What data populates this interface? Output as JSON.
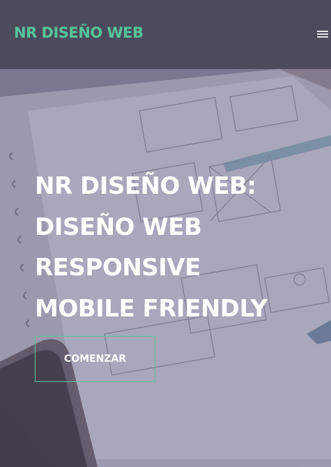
{
  "navbar": {
    "brand": "NR DISEÑO WEB",
    "menu_icon": "hamburger-menu-icon"
  },
  "hero": {
    "headline_lines": [
      "NR DISEÑO WEB:",
      "DISEÑO WEB",
      "RESPONSIVE",
      "MOBILE FRIENDLY"
    ],
    "cta_label": "COMENZAR",
    "background": "photo of notebook with website wireframe sketches, pen and phone"
  },
  "colors": {
    "accent": "#56c49c",
    "navbar_bg": "#4c4b5c",
    "hero_overlay": "#7e7b92",
    "text": "#ffffff"
  }
}
